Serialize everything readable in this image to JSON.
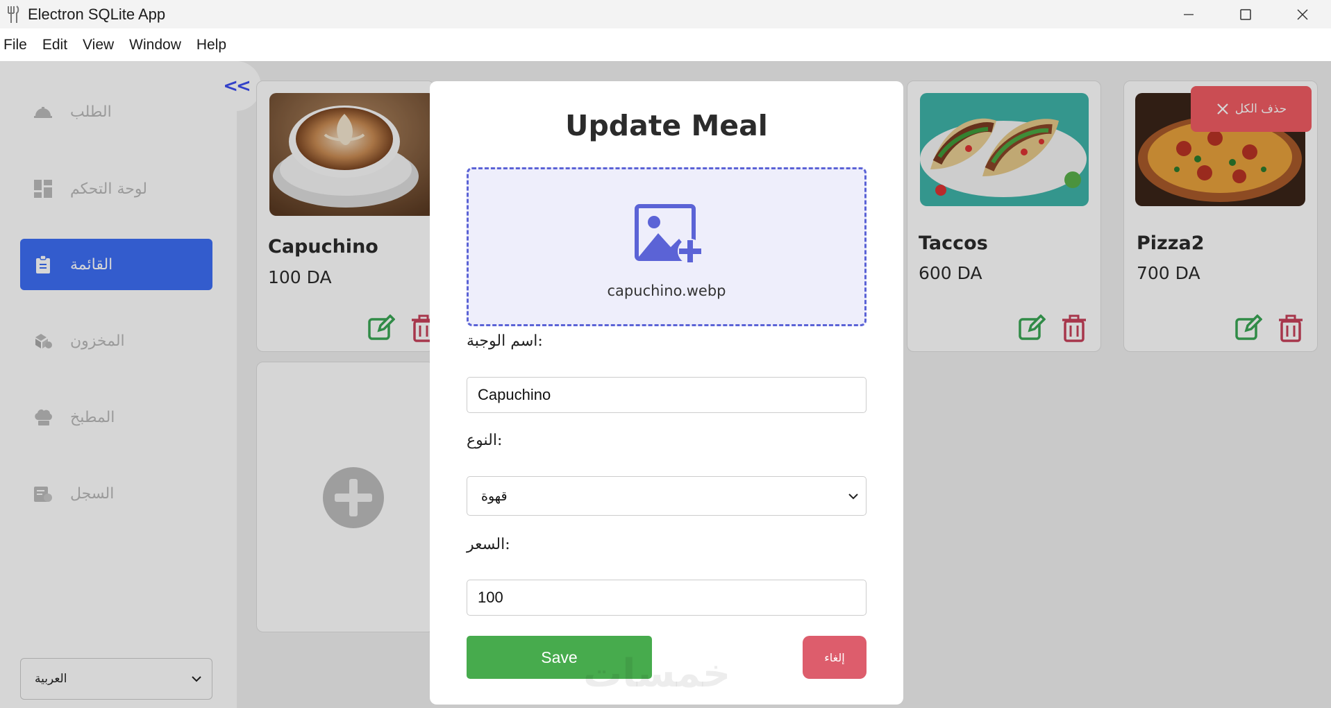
{
  "window": {
    "title": "Electron SQLite App",
    "controls": [
      "minimize-icon",
      "maximize-icon",
      "close-icon"
    ]
  },
  "menu": [
    "File",
    "Edit",
    "View",
    "Window",
    "Help"
  ],
  "sidebar": {
    "collapse_label": "<<",
    "items": [
      {
        "label": "الطلب",
        "icon": "order-icon",
        "active": false
      },
      {
        "label": "لوحة التحكم",
        "icon": "dashboard-icon",
        "active": false
      },
      {
        "label": "القائمة",
        "icon": "menu-list-icon",
        "active": true
      },
      {
        "label": "المخزون",
        "icon": "inventory-icon",
        "active": false
      },
      {
        "label": "المطبخ",
        "icon": "chef-hat-icon",
        "active": false
      },
      {
        "label": "السجل",
        "icon": "history-icon",
        "active": false
      }
    ],
    "language": "العربية"
  },
  "delete_all_label": "حذف الكل",
  "meals": [
    {
      "name": "Capuchino",
      "price": "100 DA",
      "image": "coffee-photo"
    },
    {
      "name": "Taccos",
      "price": "600 DA",
      "image": "tacos-photo"
    },
    {
      "name": "Pizza2",
      "price": "700 DA",
      "image": "pizza-photo"
    }
  ],
  "modal": {
    "title": "Update Meal",
    "file_name": "capuchino.webp",
    "name_label": "اسم الوجبة:",
    "name_value": "Capuchino",
    "type_label": "النوع:",
    "type_value": "قهوة",
    "price_label": "السعر:",
    "price_value": "100",
    "save_label": "Save",
    "cancel_label": "إلغاء"
  },
  "watermark": "خمسات",
  "colors": {
    "accent": "#3d6ef5",
    "danger": "#f15c63",
    "save": "#47ab4d",
    "cancel": "#dd5d6c",
    "edit_icon": "#3aa655",
    "delete_icon": "#c8415a"
  }
}
